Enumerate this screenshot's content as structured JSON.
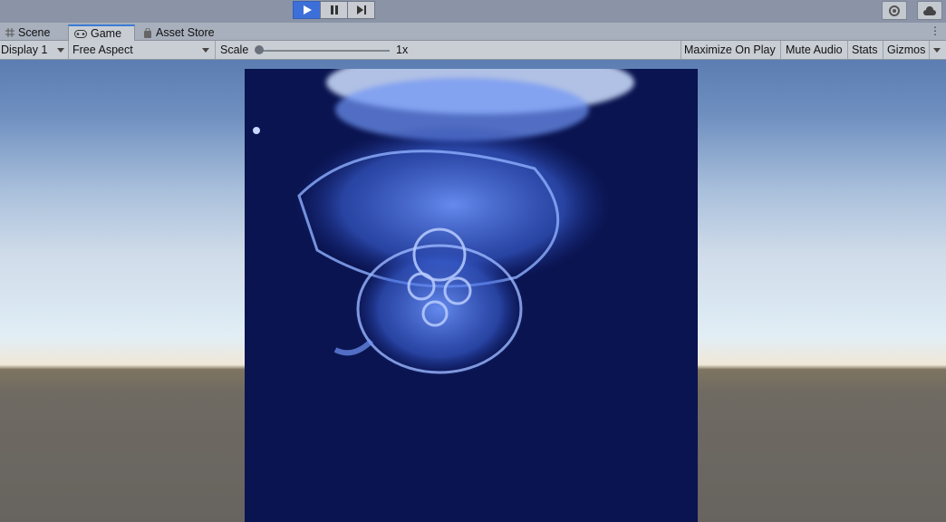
{
  "playbar": {
    "play": "play-icon",
    "pause": "pause-icon",
    "step": "step-icon",
    "right_icons": [
      "collab-icon",
      "cloud-icon"
    ]
  },
  "tabs": [
    {
      "label": "Scene",
      "icon": "grid-icon"
    },
    {
      "label": "Game",
      "icon": "gamepad-icon"
    },
    {
      "label": "Asset Store",
      "icon": "bag-icon"
    }
  ],
  "toolbar": {
    "display": "Display 1",
    "aspect": "Free Aspect",
    "scale_label": "Scale",
    "scale_value": "1x",
    "maximize": "Maximize On Play",
    "mute": "Mute Audio",
    "stats": "Stats",
    "gizmos": "Gizmos"
  },
  "colors": {
    "accent": "#3d6fd9",
    "canvas": "#0a1450",
    "jellyfish": "#4f7cf0"
  },
  "game_view": {
    "scene": "jellyfish-image"
  }
}
